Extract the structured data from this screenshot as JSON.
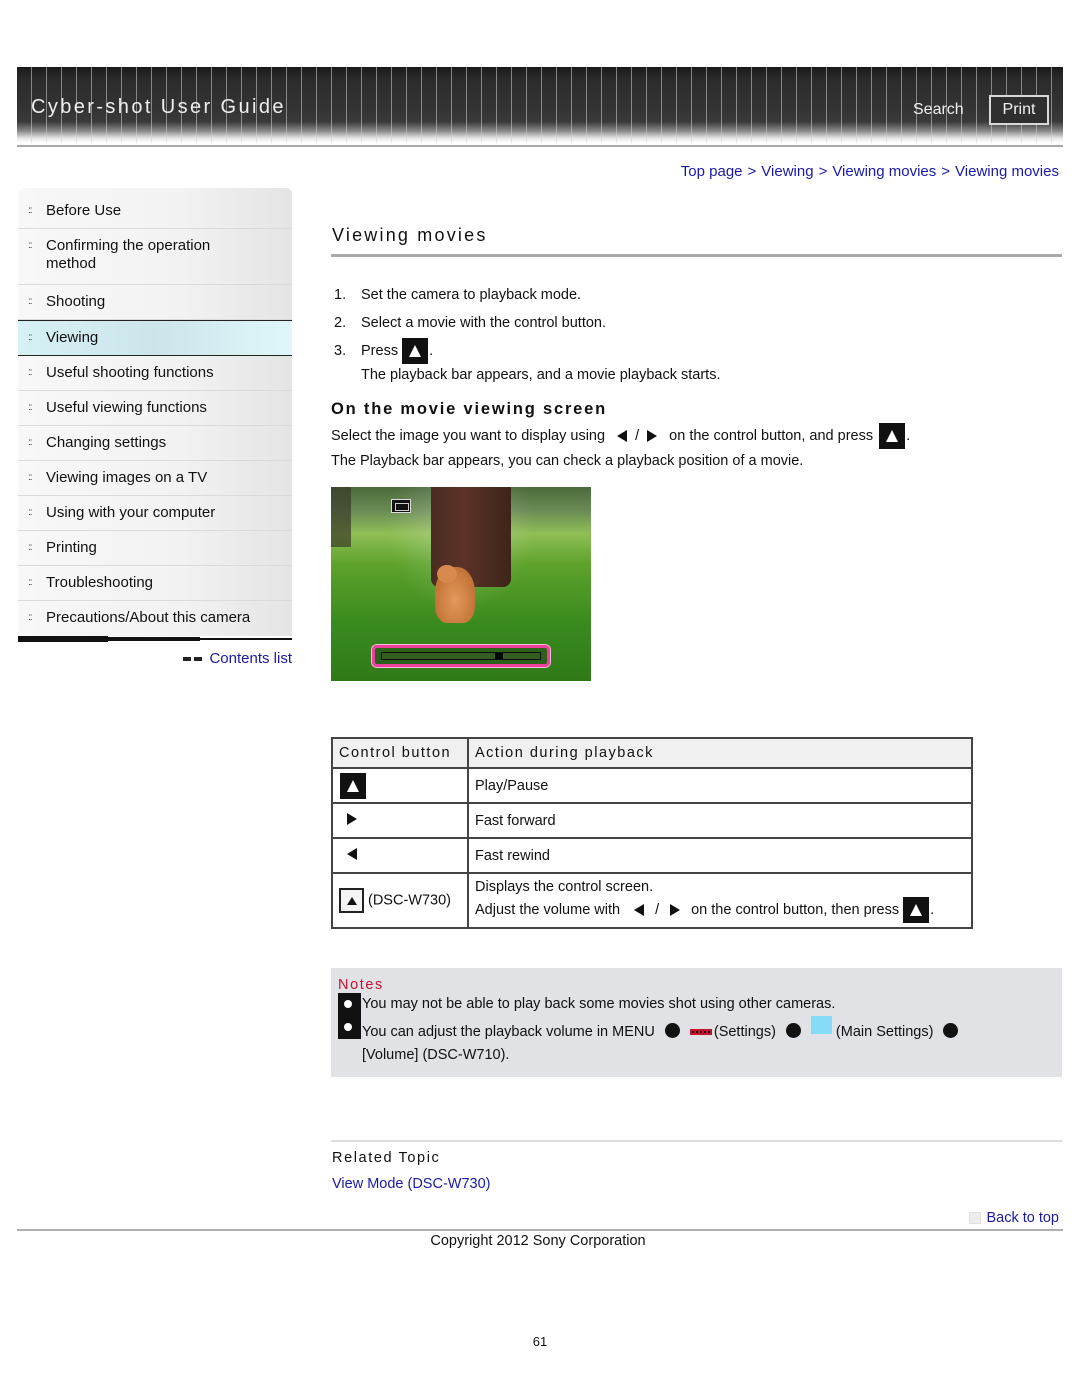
{
  "header": {
    "app_title": "Cyber-shot User Guide",
    "search_label": "Search",
    "print_label": "Print"
  },
  "breadcrumb": [
    {
      "label": "Top page"
    },
    {
      "label": "Viewing"
    },
    {
      "label": "Viewing movies"
    },
    {
      "label": "Viewing movies"
    }
  ],
  "breadcrumb_separator": ">",
  "sidebar": {
    "items": [
      {
        "label": "Before Use",
        "active": false
      },
      {
        "label": "Confirming the operation method",
        "active": false
      },
      {
        "label": "Shooting",
        "active": false
      },
      {
        "label": "Viewing",
        "active": true
      },
      {
        "label": "Useful shooting functions",
        "active": false
      },
      {
        "label": "Useful viewing functions",
        "active": false
      },
      {
        "label": "Changing settings",
        "active": false
      },
      {
        "label": "Viewing images on a TV",
        "active": false
      },
      {
        "label": "Using with your computer",
        "active": false
      },
      {
        "label": "Printing",
        "active": false
      },
      {
        "label": "Troubleshooting",
        "active": false
      },
      {
        "label": "Precautions/About this camera",
        "active": false
      }
    ],
    "bullet": "::",
    "contents_list_label": "Contents list"
  },
  "main": {
    "title": "Viewing movies",
    "steps": [
      {
        "num": "1.",
        "text": "Set the camera to playback mode."
      },
      {
        "num": "2.",
        "text": "Select a movie with the control button."
      },
      {
        "num": "3.",
        "text": "Press",
        "icon": "play-up-button-icon",
        "after": ".",
        "sub": "The playback bar appears, and a movie playback starts."
      }
    ],
    "section": {
      "heading": "On the movie viewing screen",
      "para1_a": "Select the image you want to display using",
      "para1_slash": "/",
      "para1_b": "on the control button, and press",
      "para1_end": ".",
      "para2": "The Playback bar appears, you can check a playback position of a movie."
    },
    "screen_image": {
      "alt": "Movie playback screen showing a cat in grass with playback bar",
      "playback_position_fraction": 0.75
    },
    "table": {
      "headers": [
        "Control button",
        "Action during playback"
      ],
      "rows": [
        {
          "button_icon": "play-up-button-icon",
          "button_label": "",
          "action": "Play/Pause"
        },
        {
          "button_icon": "right-arrow-icon",
          "button_label": "",
          "action": "Fast forward"
        },
        {
          "button_icon": "left-arrow-icon",
          "button_label": "",
          "action": "Fast rewind"
        },
        {
          "button_icon": "down-button-icon",
          "button_label": "(DSC-W730)",
          "action": "Displays the control screen.",
          "action_line2_a": "Adjust the volume with",
          "action_line2_slash": "/",
          "action_line2_b": "on the control button, then press",
          "action_line2_end": "."
        }
      ]
    },
    "notes": {
      "title": "Notes",
      "items": [
        {
          "text": "You may not be able to play back some movies shot using other cameras."
        },
        {
          "text_a": "You can adjust the playback volume in MENU",
          "settings_label": "(Settings)",
          "main_settings_label": "(Main Settings)",
          "continuation": "[Volume] (DSC-W710)."
        }
      ]
    },
    "related": {
      "title": "Related Topic",
      "links": [
        {
          "label": "View Mode (DSC-W730)"
        }
      ]
    }
  },
  "footer": {
    "back_to_top": "Back to top",
    "copyright": "Copyright 2012 Sony Corporation",
    "page_number": "61"
  },
  "colors": {
    "link": "#1a1aa6",
    "notes_title": "#c8102e",
    "active_nav": "#d6f1f6",
    "notes_bg": "#e0e2e6",
    "playback_bar": "#ee3f9e",
    "main_settings_chip": "#86dcf7"
  }
}
